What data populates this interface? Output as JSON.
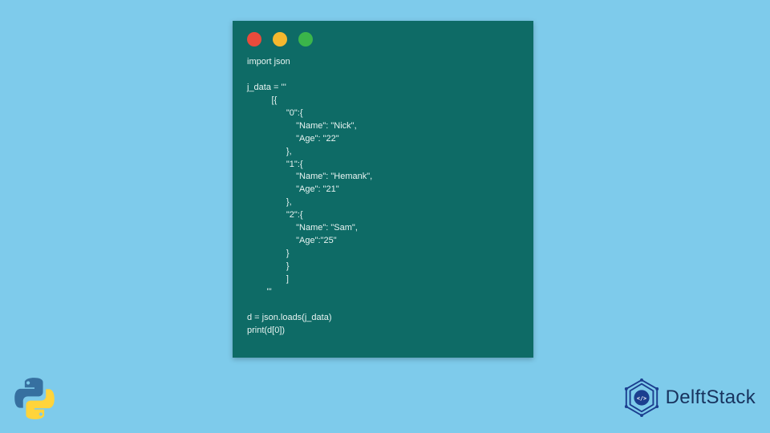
{
  "window": {
    "dots": {
      "red": "#e94b3c",
      "yellow": "#f5b82e",
      "green": "#3bb54a"
    }
  },
  "code": {
    "content": "import json\n\nj_data = '''\n          [{\n                \"0\":{\n                    \"Name\": \"Nick\",\n                    \"Age\": \"22\"\n                },\n                \"1\":{\n                    \"Name\": \"Hemank\",\n                    \"Age\": \"21\"\n                },\n                \"2\":{\n                    \"Name\": \"Sam\",\n                    \"Age\":\"25\"\n                }\n                }\n                ]\n        '''\n\nd = json.loads(j_data)\nprint(d[0])"
  },
  "brand": {
    "name": "DelftStack"
  },
  "logos": {
    "python_alt": "python-logo",
    "delft_alt": "delftstack-logo"
  }
}
